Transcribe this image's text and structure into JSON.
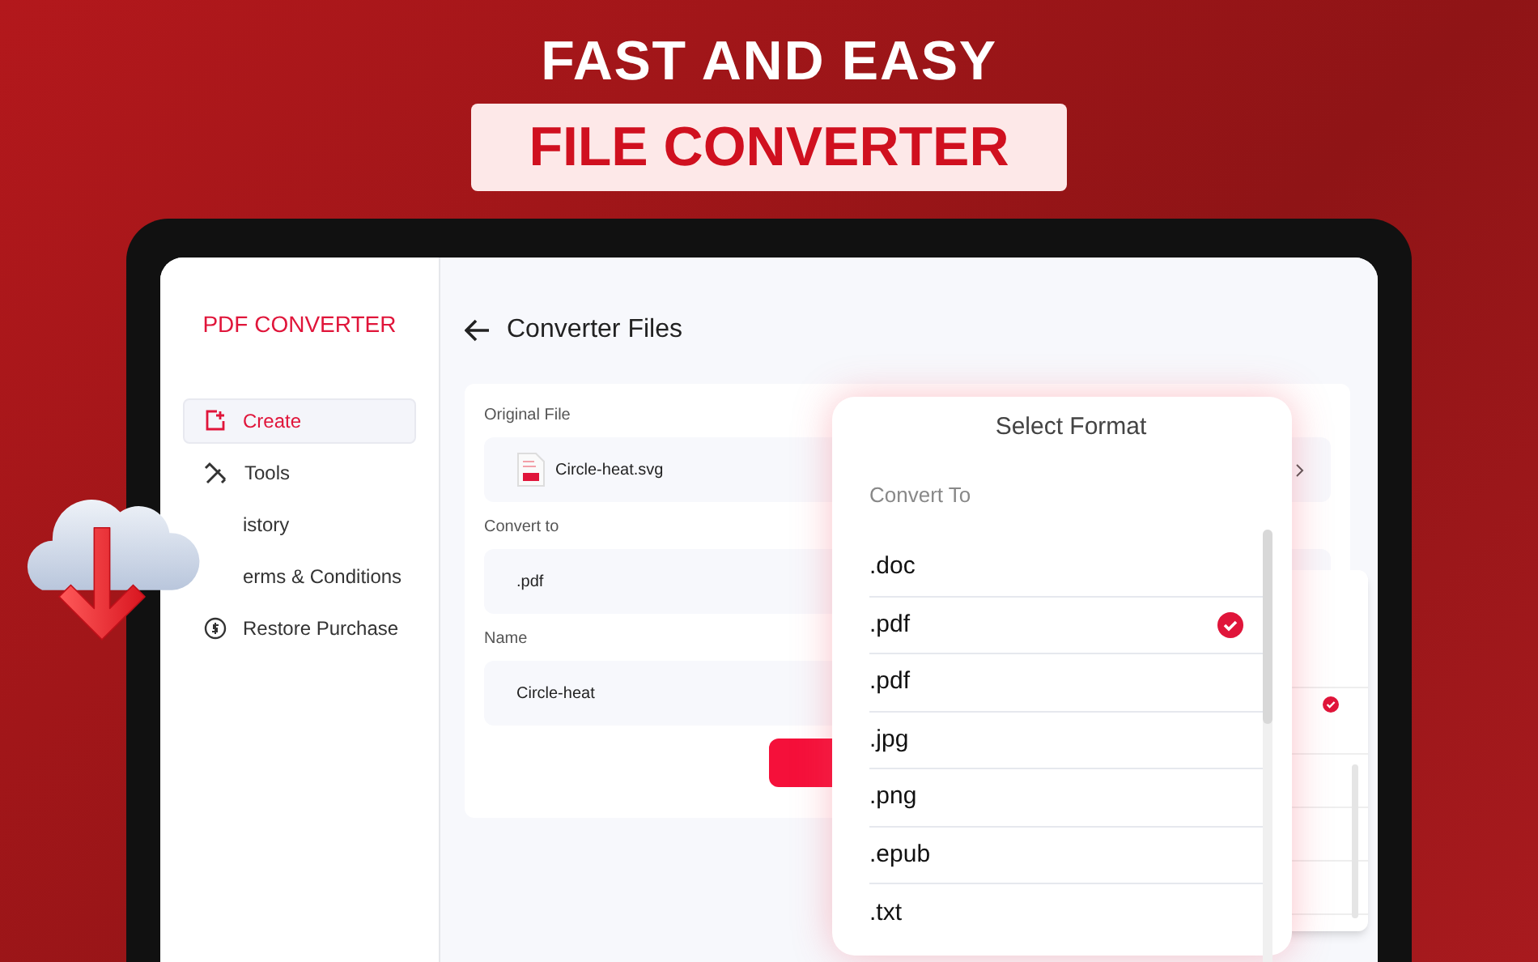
{
  "headline": "FAST AND EASY",
  "banner": "FILE CONVERTER",
  "sidebar": {
    "brand": "PDF CONVERTER",
    "items": [
      {
        "label": "Create",
        "kind": "create",
        "selected": true
      },
      {
        "label": "Tools",
        "kind": "tools",
        "selected": false
      },
      {
        "label": "istory",
        "kind": "history",
        "selected": false
      },
      {
        "label": "erms & Conditions",
        "kind": "terms",
        "selected": false
      },
      {
        "label": "Restore Purchase",
        "kind": "restore",
        "selected": false
      }
    ]
  },
  "page": {
    "title": "Converter Files",
    "fields": [
      {
        "label": "Original File",
        "value": "Circle-heat.svg",
        "kind": "file"
      },
      {
        "label": "Convert to",
        "value": ".pdf",
        "kind": "text"
      },
      {
        "label": "Name",
        "value": "Circle-heat",
        "kind": "text"
      }
    ]
  },
  "format_dialog": {
    "title": "Select Format",
    "subtitle": "Convert To",
    "options": [
      {
        "label": ".doc",
        "selected": false
      },
      {
        "label": ".pdf",
        "selected": true
      },
      {
        "label": ".pdf",
        "selected": false
      },
      {
        "label": ".jpg",
        "selected": false
      },
      {
        "label": ".png",
        "selected": false
      },
      {
        "label": ".epub",
        "selected": false
      },
      {
        "label": ".txt",
        "selected": false
      }
    ]
  }
}
